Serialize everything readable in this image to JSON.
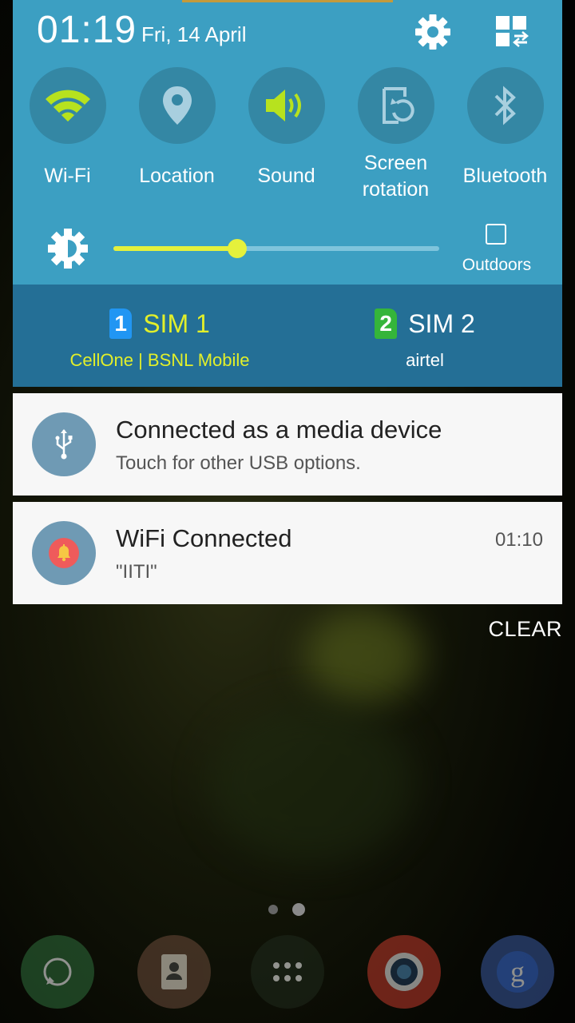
{
  "status": {
    "time": "01:19",
    "date": "Fri, 14 April"
  },
  "quick_toggles": [
    {
      "label": "Wi-Fi",
      "icon": "wifi-icon",
      "active": true
    },
    {
      "label": "Location",
      "icon": "location-icon",
      "active": false
    },
    {
      "label": "Sound",
      "icon": "sound-icon",
      "active": true
    },
    {
      "label_line1": "Screen",
      "label_line2": "rotation",
      "icon": "screen-rotation-icon",
      "active": false
    },
    {
      "label": "Bluetooth",
      "icon": "bluetooth-icon",
      "active": false
    }
  ],
  "brightness": {
    "level": 0.38,
    "outdoors_label": "Outdoors",
    "outdoors_checked": false
  },
  "sims": [
    {
      "badge": "1",
      "name": "SIM 1",
      "carrier": "CellOne | BSNL Mobile",
      "color": "#e2ef2a",
      "badge_color": "#2196f3"
    },
    {
      "badge": "2",
      "name": "SIM 2",
      "carrier": "airtel",
      "color": "#ffffff",
      "badge_color": "#35b53a"
    }
  ],
  "notifications": [
    {
      "title": "Connected as a media device",
      "subtitle": "Touch for other USB options.",
      "time": "",
      "icon": "usb-icon"
    },
    {
      "title": "WiFi Connected",
      "subtitle": "\"IITI\"",
      "time": "01:10",
      "icon": "bell-icon"
    }
  ],
  "clear_label": "CLEAR",
  "colors": {
    "panel": "#3c9fc2",
    "sim_bar": "#246f96",
    "accent_active": "#b7e21e"
  },
  "dock": [
    {
      "icon": "whatsapp-icon"
    },
    {
      "icon": "contacts-icon"
    },
    {
      "icon": "apps-icon"
    },
    {
      "icon": "camera-icon"
    },
    {
      "icon": "google-icon"
    }
  ]
}
